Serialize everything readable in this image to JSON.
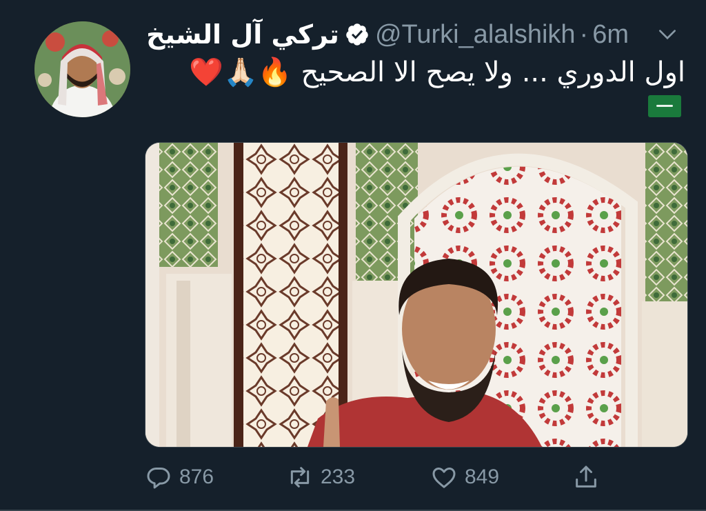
{
  "tweet": {
    "author_name": "تركي آل الشيخ",
    "handle": "@Turki_alalshikh",
    "separator": "·",
    "time": "6m",
    "text": "اول الدوري ... ولا يصح الا الصحيح 🔥🙏🏻❤️",
    "icons": {
      "verified": "verified-badge-icon",
      "menu": "chevron-down-icon",
      "flag": "saudi-flag-emoji"
    }
  },
  "actions": {
    "reply_count": "876",
    "retweet_count": "233",
    "like_count": "849",
    "icons": [
      "reply-icon",
      "retweet-icon",
      "like-icon",
      "share-icon"
    ]
  },
  "colors": {
    "background": "#15202b",
    "secondary_text": "#8899a6",
    "border": "#38444d"
  }
}
